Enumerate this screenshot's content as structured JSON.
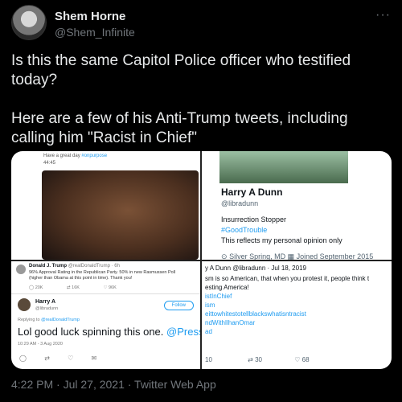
{
  "author": {
    "name": "Shem Horne",
    "handle": "@Shem_Infinite",
    "more_icon": "more-dots-icon"
  },
  "tweet": {
    "text": "Is this the same Capitol Police officer who testified today?\n\nHere are a few of his Anti-Trump tweets, including calling him \"Racist in Chief\"",
    "timestamp": "4:22 PM · Jul 27, 2021 · Twitter Web App"
  },
  "media": {
    "top_left": {
      "line1": "Have a great day",
      "hashtag": "#onpurpose",
      "time": "44:45"
    },
    "top_right": {
      "name": "Harry A Dunn",
      "handle": "@libradunn",
      "bio1": "Insurrection Stopper",
      "bio_link": "#GoodTrouble",
      "bio2": "This reflects my personal opinion only",
      "location": "Silver Spring, MD",
      "joined": "Joined September 2015"
    },
    "bottom_left": {
      "quoted_name": "Donald J. Trump",
      "quoted_handle": "@realDonaldTrump · 6h",
      "quoted_text": "96% Approval Rating in the Republican Party. 50% in new Rasmussen Poll (higher than Obama at this point in time). Thank you!",
      "stat_replies": "20K",
      "stat_retweets": "16K",
      "stat_likes": "96K",
      "reply_name": "Harry A",
      "reply_handle": "@libradunn",
      "follow_label": "Follow",
      "replying_to": "Replying to",
      "replying_handle": "@realDonaldTrump",
      "reply_text": "Lol good luck spinning this one.",
      "reply_mention": "@PressSec",
      "reply_time": "10:29 AM - 3 Aug 2020"
    },
    "bottom_right": {
      "header": "y A Dunn @libradunn · Jul 18, 2019",
      "line1": "sm is so American, that when you protest it, people think t",
      "line2": "esting America!",
      "tag1": "istInChief",
      "tag2": "ism",
      "tag3": "eittowhitestotellblackswhatisntracist",
      "tag4": "ndWithIlhanOmar",
      "tag5": "ad",
      "stat_replies": "10",
      "stat_retweets": "30",
      "stat_likes": "68"
    }
  }
}
